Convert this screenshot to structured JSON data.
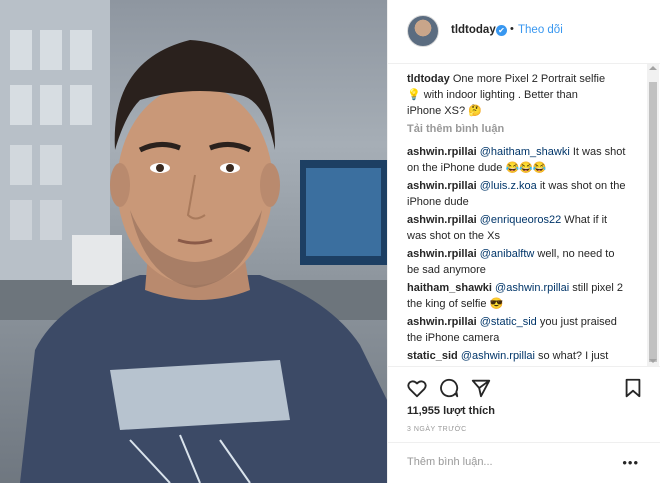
{
  "post": {
    "username": "tldtoday",
    "follow_label": "Theo dõi",
    "dot": "•",
    "verified_mark": "✔"
  },
  "caption": {
    "username": "tldtoday",
    "text_1": "One more Pixel 2 Portrait selfie",
    "text_2": "with indoor lighting . Better than",
    "text_3": "iPhone XS? 🤔",
    "lightbulb": "💡"
  },
  "load_more": "Tải thêm bình luận",
  "comments": [
    {
      "user": "ashwin.rpillai",
      "mention": "@haitham_shawki",
      "text_a": " It was shot",
      "text_b": "on the iPhone dude 😂😂😂"
    },
    {
      "user": "ashwin.rpillai",
      "mention": "@luis.z.koa",
      "text_a": " it was shot on the",
      "text_b": "iPhone dude"
    },
    {
      "user": "ashwin.rpillai",
      "mention": "@enriqueoros22",
      "text_a": " What if it",
      "text_b": "was shot on the Xs"
    },
    {
      "user": "ashwin.rpillai",
      "mention": "@anibalftw",
      "text_a": " well, no need to",
      "text_b": "be sad anymore"
    },
    {
      "user": "haitham_shawki",
      "mention": "@ashwin.rpillai",
      "text_a": " still pixel 2",
      "text_b": "the king of selfie 😎"
    },
    {
      "user": "ashwin.rpillai",
      "mention": "@static_sid",
      "text_a": " you just praised",
      "text_b": "the iPhone camera"
    },
    {
      "user": "static_sid",
      "mention": "@ashwin.rpillai",
      "text_a": " so what? I just",
      "text_b": ""
    }
  ],
  "likes": "11,955 lượt thích",
  "timestamp": "3 NGÀY TRƯỚC",
  "add_comment_placeholder": "Thêm bình luận...",
  "more_options": "•••",
  "colors": {
    "link": "#3897f0",
    "mention": "#003569",
    "muted": "#999999"
  },
  "icons": [
    "heart-icon",
    "comment-icon",
    "share-icon",
    "bookmark-icon"
  ]
}
